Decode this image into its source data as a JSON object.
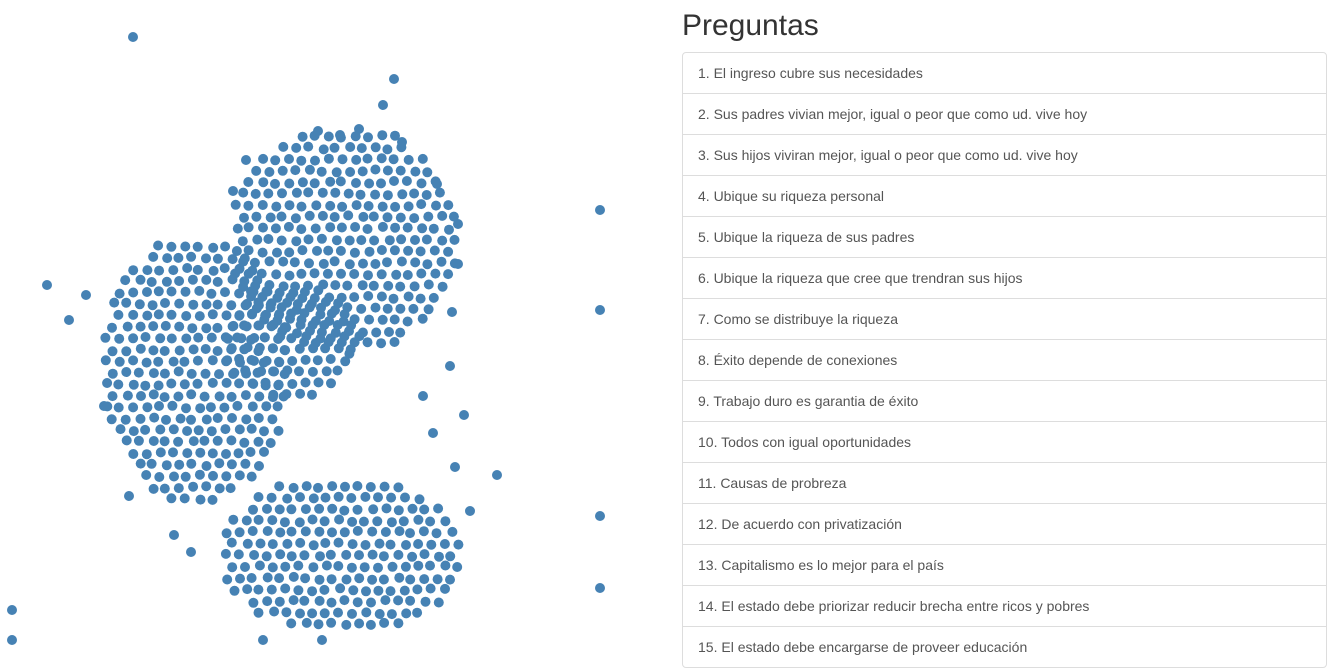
{
  "panel": {
    "title": "Preguntas"
  },
  "questions": [
    "1. El ingreso cubre sus necesidades",
    "2. Sus padres vivian mejor, igual o peor que como ud. vive hoy",
    "3. Sus hijos viviran mejor, igual o peor que como ud. vive hoy",
    "4. Ubique su riqueza personal",
    "5. Ubique la riqueza de sus padres",
    "6. Ubique la riqueza que cree que trendran sus hijos",
    "7. Como se distribuye la riqueza",
    "8. Éxito depende de conexiones",
    "9. Trabajo duro es garantia de éxito",
    "10. Todos con igual oportunidades",
    "11. Causas de probreza",
    "12. De acuerdo con privatización",
    "13. Capitalismo es lo mejor para el país",
    "14. El estado debe priorizar reducir brecha entre ricos y pobres",
    "15. El estado debe encargarse de proveer educación"
  ],
  "colors": {
    "dot": "#4682b4",
    "border": "#dddddd",
    "text": "#555555",
    "heading": "#333333"
  }
}
